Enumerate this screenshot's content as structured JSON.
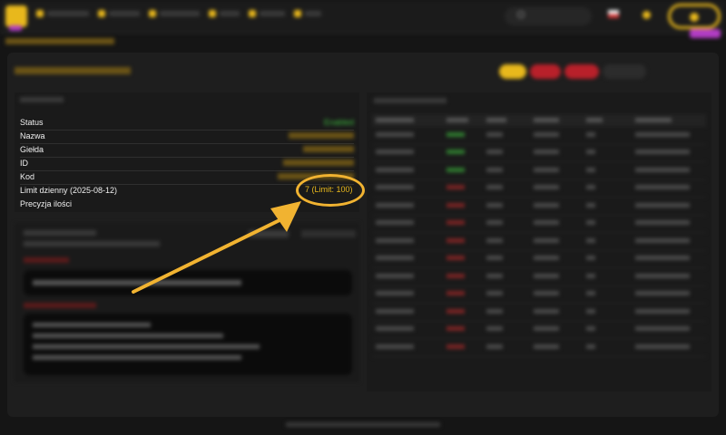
{
  "info_rows": [
    {
      "label": "Status",
      "value": "Enabled"
    },
    {
      "label": "Nazwa",
      "value": ""
    },
    {
      "label": "Giełda",
      "value": ""
    },
    {
      "label": "ID",
      "value": ""
    },
    {
      "label": "Kod",
      "value": ""
    },
    {
      "label": "Limit dzienny (2025-08-12)",
      "value": "7 (Limit: 100)"
    },
    {
      "label": "Precyzja ilości",
      "value": ""
    }
  ],
  "colors": {
    "accent": "#e8b81c",
    "status_green": "#3fbf3f",
    "danger": "#b8202a",
    "annotation": "#f1b331"
  },
  "icons": [
    "logo-icon",
    "search-icon",
    "flag-icon",
    "bell-icon",
    "user-icon",
    "arrow-annotation"
  ]
}
